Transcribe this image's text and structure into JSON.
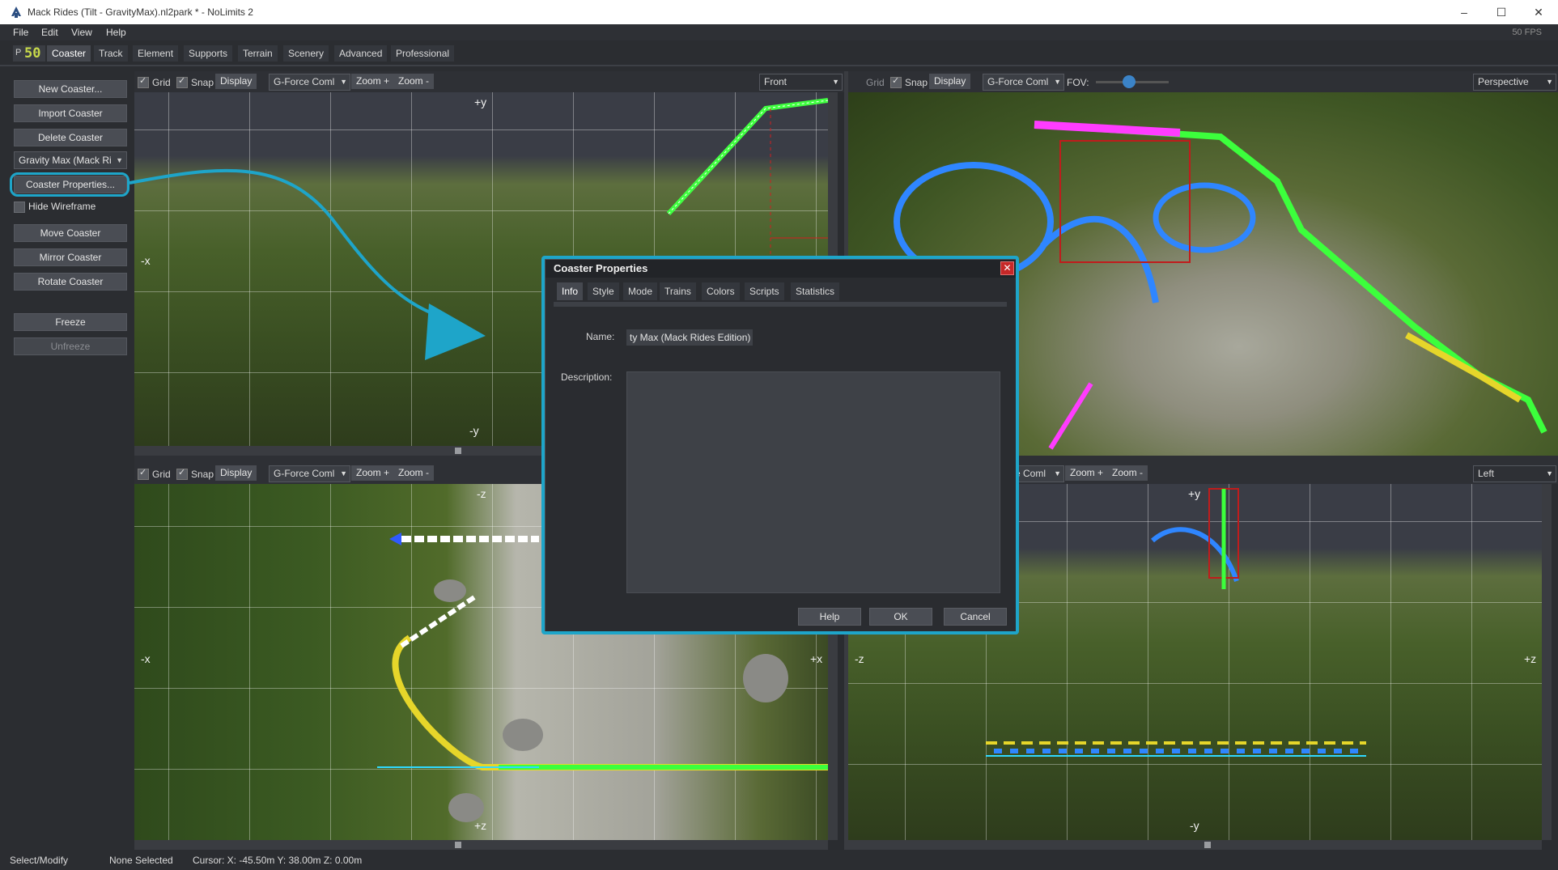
{
  "window": {
    "title": "Mack Rides (Tilt - GravityMax).nl2park * - NoLimits 2",
    "controls": [
      "–",
      "☐",
      "✕"
    ]
  },
  "menu": [
    "File",
    "Edit",
    "View",
    "Help"
  ],
  "fps_text": "50 FPS",
  "fps_badge": {
    "prefix": "P",
    "value": "50"
  },
  "mode_tabs": [
    "Coaster",
    "Track",
    "Element",
    "Supports",
    "Terrain",
    "Scenery",
    "Advanced",
    "Professional"
  ],
  "active_mode": "Coaster",
  "sidebar": {
    "new_coaster": "New Coaster...",
    "import_coaster": "Import Coaster",
    "delete_coaster": "Delete Coaster",
    "coaster_select": "Gravity Max (Mack Ri",
    "coaster_properties": "Coaster Properties...",
    "hide_wireframe": "Hide Wireframe",
    "move_coaster": "Move Coaster",
    "mirror_coaster": "Mirror Coaster",
    "rotate_coaster": "Rotate Coaster",
    "freeze": "Freeze",
    "unfreeze": "Unfreeze"
  },
  "viewport_toolbar": {
    "grid": "Grid",
    "snap": "Snap",
    "display": "Display",
    "gforce": "G-Force Coml",
    "zoom_in": "Zoom +",
    "zoom_out": "Zoom -",
    "fov": "FOV:"
  },
  "viewports": {
    "top_left": {
      "view": "Front",
      "axes": {
        "top": "+y",
        "bottom": "-y",
        "left": "-x"
      }
    },
    "top_right": {
      "view": "Perspective"
    },
    "bottom_left": {
      "axes": {
        "top": "-z",
        "bottom": "+z",
        "left": "-x",
        "right": "+x"
      }
    },
    "bottom_right": {
      "view": "Left",
      "gforce_partial": "e Coml",
      "axes": {
        "top": "+y",
        "bottom": "-y",
        "left": "-z",
        "right": "+z"
      }
    }
  },
  "dialog": {
    "title": "Coaster Properties",
    "close": "✕",
    "tabs": [
      "Info",
      "Style",
      "Mode",
      "Trains",
      "Colors",
      "Scripts",
      "Statistics"
    ],
    "active_tab": "Info",
    "name_label": "Name:",
    "name_value": "ty Max (Mack Rides Edition)",
    "description_label": "Description:",
    "description_value": "",
    "help": "Help",
    "ok": "OK",
    "cancel": "Cancel"
  },
  "status": {
    "mode": "Select/Modify",
    "selection": "None Selected",
    "cursor": "Cursor: X: -45.50m Y: 38.00m Z: 0.00m"
  },
  "annotation_color": "#1ea5c9"
}
